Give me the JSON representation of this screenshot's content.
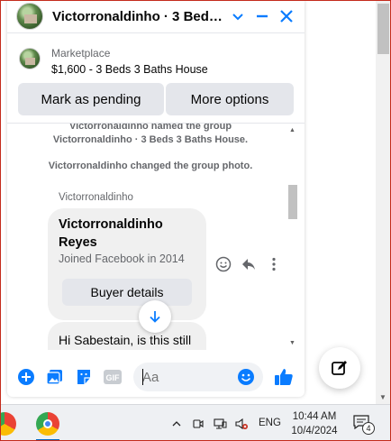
{
  "chat": {
    "title": "Victorronaldinho · 3 Beds ...",
    "listing": {
      "source": "Marketplace",
      "title": "$1,600 - 3 Beds 3 Baths House"
    },
    "actions": {
      "mark_pending": "Mark as pending",
      "more_options": "More options"
    },
    "system_messages": [
      "Victorronaldinho named the group",
      "Victorronaldinho · 3 Beds 3 Baths House.",
      "Victorronaldinho changed the group photo."
    ],
    "sender": "Victorronaldinho",
    "card": {
      "name": "Victorronaldinho Reyes",
      "joined": "Joined Facebook in 2014",
      "button": "Buyer details"
    },
    "message": "Hi Sabestain, is this still available?",
    "composer": {
      "placeholder": "Aa"
    }
  },
  "taskbar": {
    "language": "ENG",
    "time": "10:44 AM",
    "date": "10/4/2024",
    "notification_count": "4"
  },
  "colors": {
    "accent": "#0a7cff",
    "bubble": "#f0f0f0",
    "button": "#e4e6eb",
    "muted_text": "#65676b"
  }
}
